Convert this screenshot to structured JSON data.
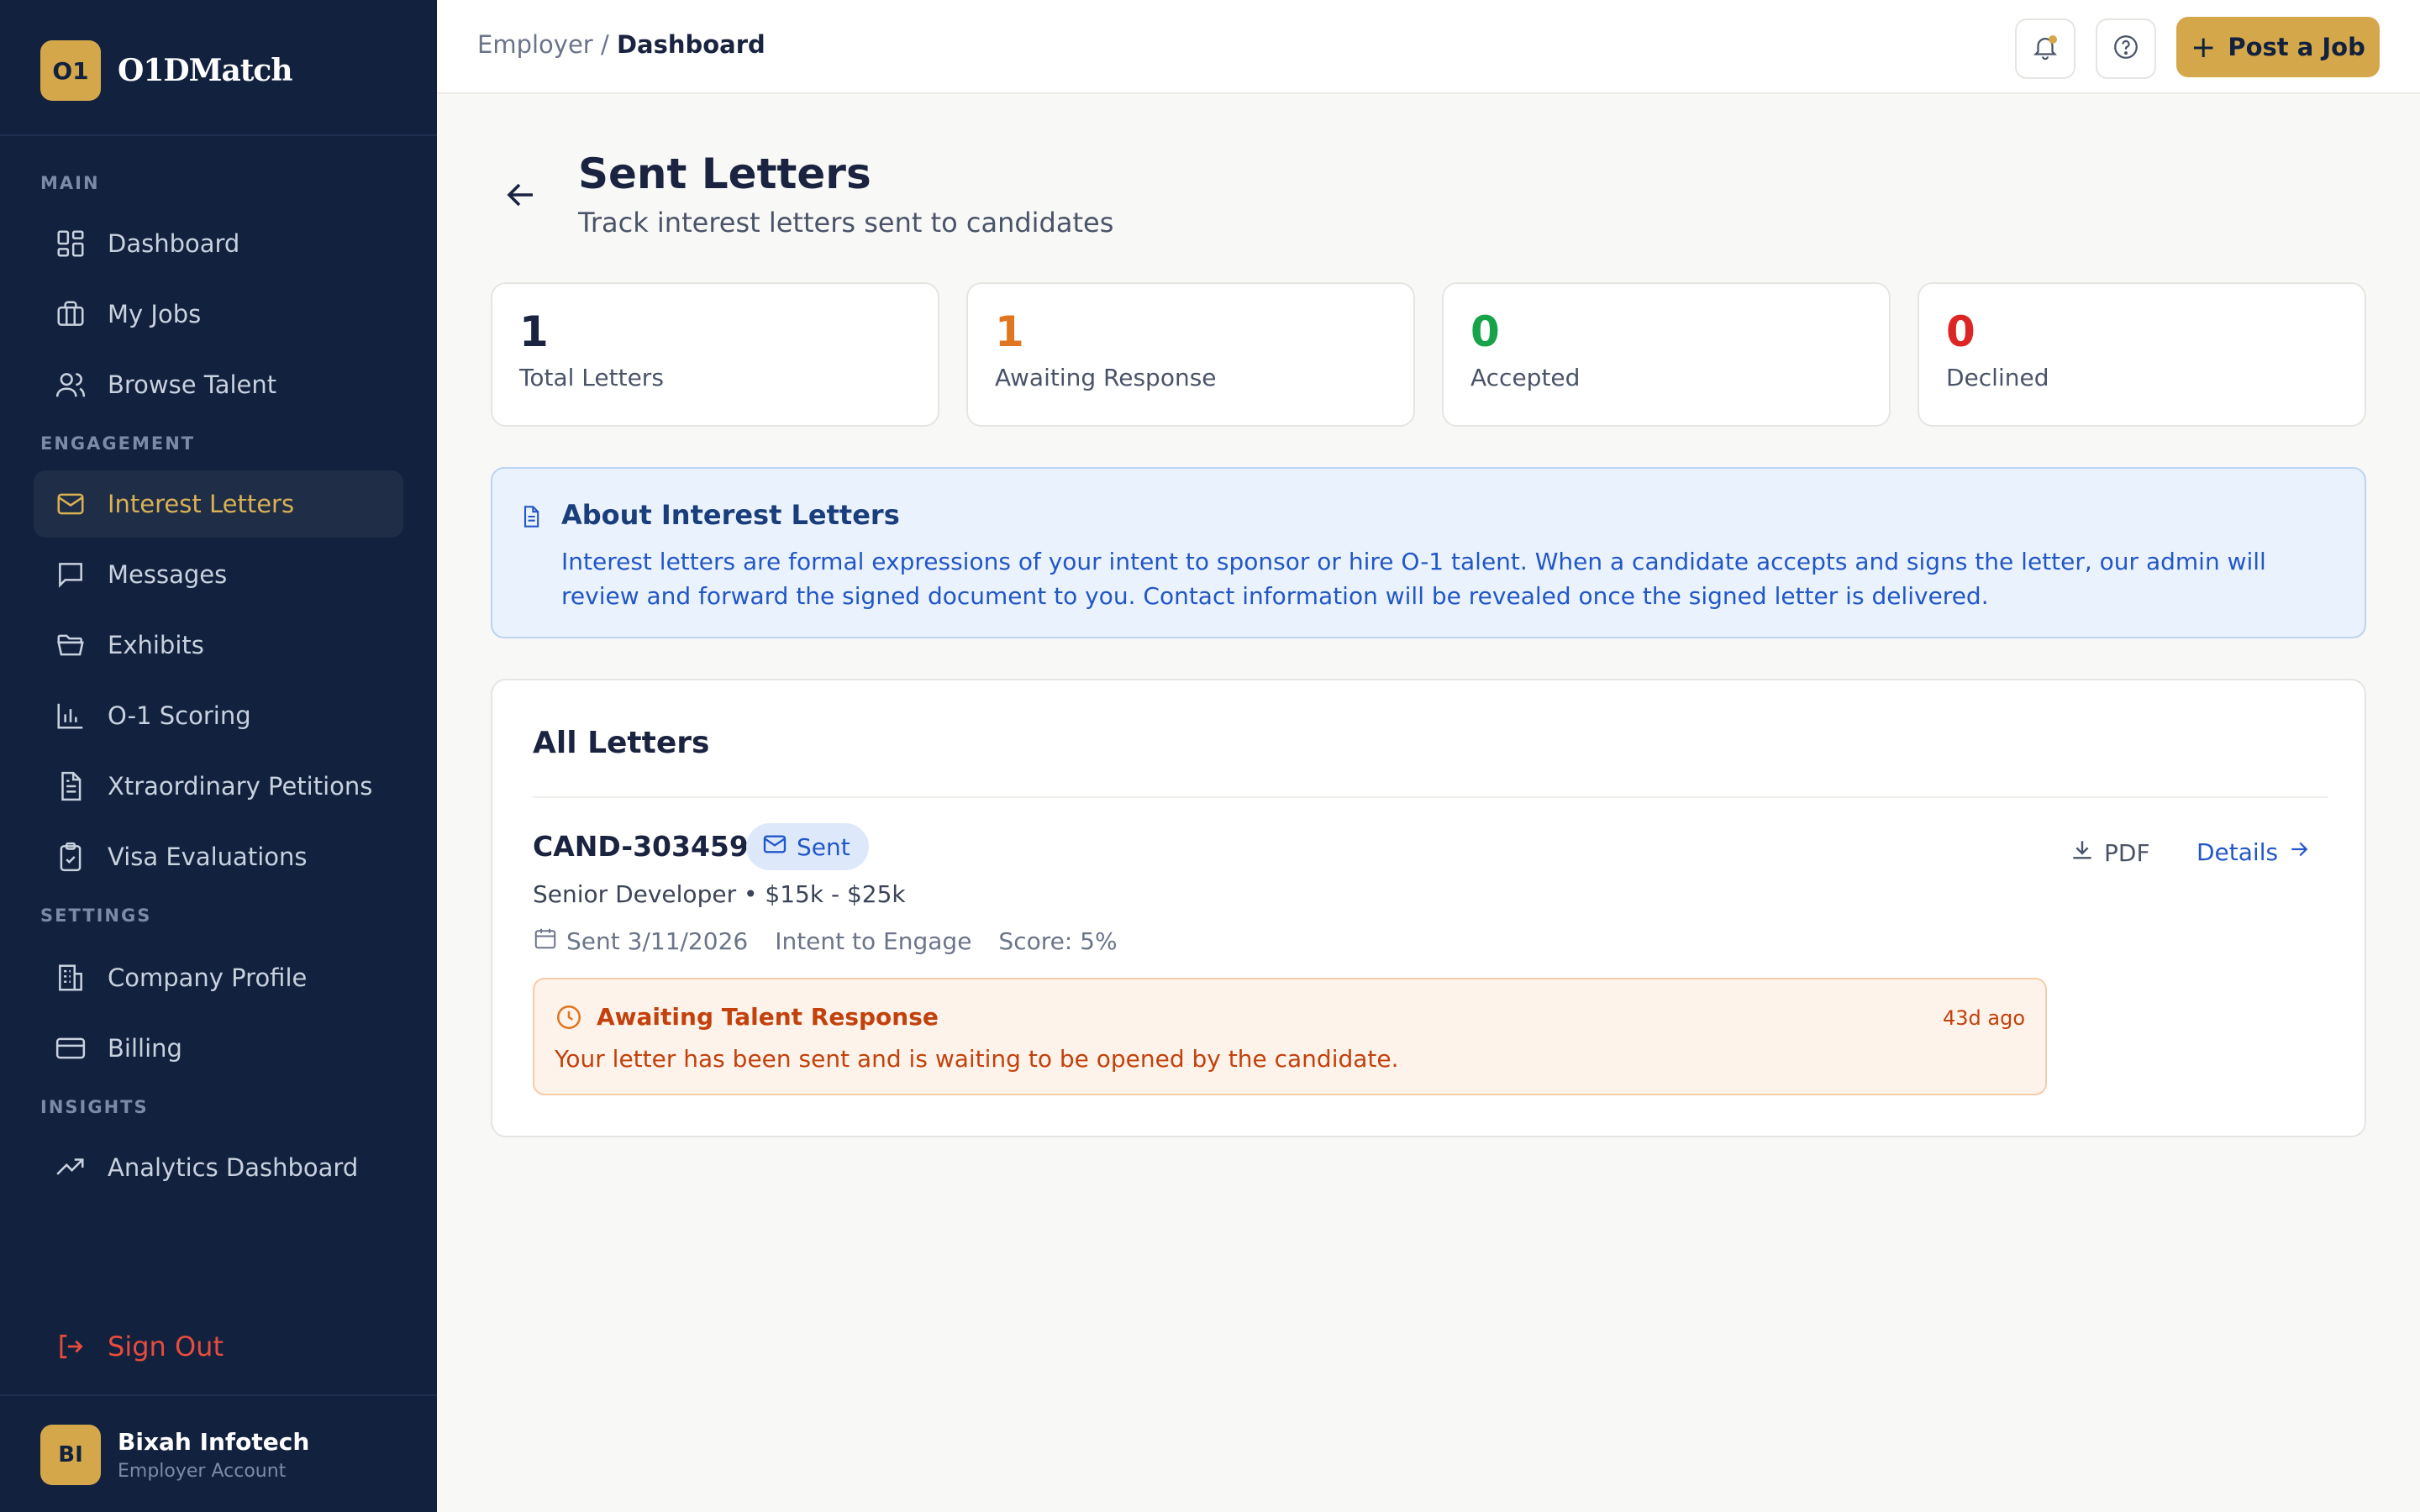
{
  "brand": {
    "badge": "O1",
    "name": "O1DMatch"
  },
  "sidebar": {
    "sections": {
      "main": "MAIN",
      "engagement": "ENGAGEMENT",
      "settings": "SETTINGS",
      "insights": "INSIGHTS"
    },
    "items": [
      {
        "label": "Dashboard",
        "icon": "dashboard-icon"
      },
      {
        "label": "My Jobs",
        "icon": "briefcase-icon"
      },
      {
        "label": "Browse Talent",
        "icon": "users-icon"
      },
      {
        "label": "Interest Letters",
        "icon": "mail-icon",
        "active": true
      },
      {
        "label": "Messages",
        "icon": "message-icon"
      },
      {
        "label": "Exhibits",
        "icon": "folder-icon"
      },
      {
        "label": "O-1 Scoring",
        "icon": "bar-chart-icon"
      },
      {
        "label": "Xtraordinary Petitions",
        "icon": "file-icon"
      },
      {
        "label": "Visa Evaluations",
        "icon": "clipboard-icon"
      },
      {
        "label": "Company Profile",
        "icon": "building-icon"
      },
      {
        "label": "Billing",
        "icon": "credit-card-icon"
      },
      {
        "label": "Analytics Dashboard",
        "icon": "trending-icon"
      }
    ],
    "sign_out": "Sign Out",
    "user": {
      "initials": "BI",
      "name": "Bixah Infotech",
      "role": "Employer Account"
    }
  },
  "topbar": {
    "breadcrumb_parent": "Employer",
    "breadcrumb_sep": "/",
    "breadcrumb_current": "Dashboard",
    "post_job_label": "Post a Job"
  },
  "page": {
    "title": "Sent Letters",
    "subtitle": "Track interest letters sent to candidates"
  },
  "stats": [
    {
      "value": "1",
      "label": "Total Letters",
      "color": "#1a2440"
    },
    {
      "value": "1",
      "label": "Awaiting Response",
      "color": "#e0761f"
    },
    {
      "value": "0",
      "label": "Accepted",
      "color": "#16a34a"
    },
    {
      "value": "0",
      "label": "Declined",
      "color": "#dc2626"
    }
  ],
  "info": {
    "title": "About Interest Letters",
    "text": "Interest letters are formal expressions of your intent to sponsor or hire O-1 talent. When a candidate accepts and signs the letter, our admin will review and forward the signed document to you. Contact information will be revealed once the signed letter is delivered."
  },
  "letters": {
    "title": "All Letters",
    "items": [
      {
        "candidate_id": "CAND-303459",
        "status": "Sent",
        "role": "Senior Developer • $15k - $25k",
        "sent": "Sent 3/11/2026",
        "type": "Intent to Engage",
        "score": "Score: 5%",
        "pdf_label": "PDF",
        "details_label": "Details",
        "await_title": "Awaiting Talent Response",
        "await_time": "43d ago",
        "await_text": "Your letter has been sent and is waiting to be opened by the candidate."
      }
    ]
  }
}
